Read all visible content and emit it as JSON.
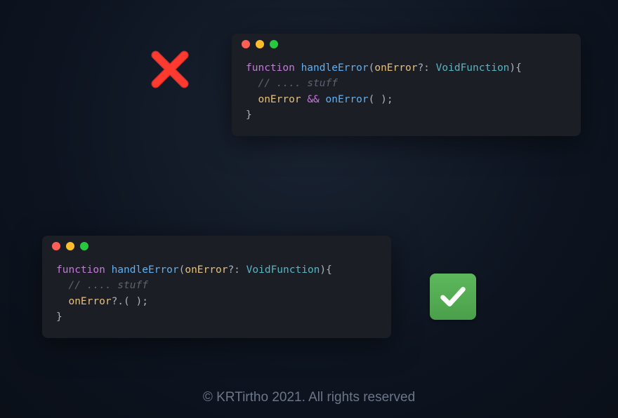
{
  "icons": {
    "cross": "cross-mark",
    "check": "check-mark"
  },
  "code1": {
    "line1": {
      "kw": "function",
      "fn": "handleError",
      "p1": "(",
      "param": "onError",
      "opt": "?:",
      "type": "VoidFunction",
      "p2": "){"
    },
    "line2": {
      "comment": "// .... stuff"
    },
    "line3": {
      "id1": "onError",
      "op": "&&",
      "id2": "onError",
      "call": "( );"
    },
    "line4": {
      "brace": "}"
    }
  },
  "code2": {
    "line1": {
      "kw": "function",
      "fn": "handleError",
      "p1": "(",
      "param": "onError",
      "opt": "?:",
      "type": "VoidFunction",
      "p2": "){"
    },
    "line2": {
      "comment": "// .... stuff"
    },
    "line3": {
      "id1": "onError",
      "opt": "?.",
      "call": "( );"
    },
    "line4": {
      "brace": "}"
    }
  },
  "footer": "© KRTirtho 2021. All rights reserved"
}
